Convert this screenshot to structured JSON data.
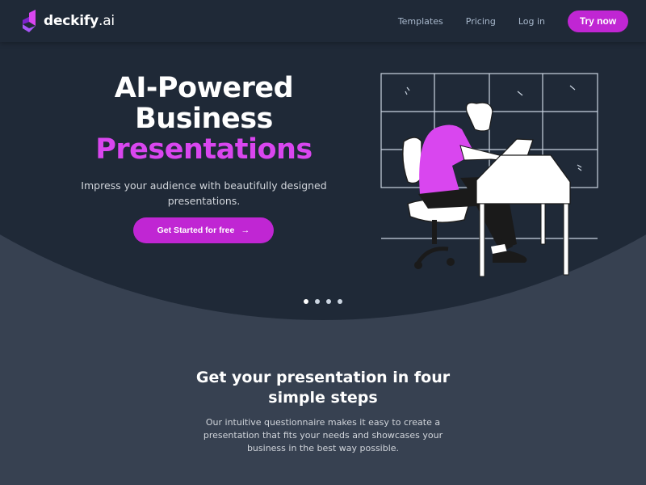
{
  "brand": {
    "name": "deckify",
    "suffix": ".ai",
    "colors": {
      "accent": "#c026d3",
      "accent_light": "#d946ef",
      "hero_bg": "#1f2937",
      "page_bg": "#374151"
    }
  },
  "nav": {
    "links": [
      {
        "label": "Templates"
      },
      {
        "label": "Pricing"
      },
      {
        "label": "Log in"
      }
    ],
    "cta_label": "Try now"
  },
  "hero": {
    "title_line1": "AI-Powered",
    "title_line2": "Business",
    "title_accent": "Presentations",
    "subtitle": "Impress your audience with beautifully designed presentations.",
    "cta_label": "Get Started for free",
    "cta_icon": "arrow-right-icon",
    "illustration": "person-working-at-laptop-desk",
    "carousel": {
      "total": 4,
      "active": 1
    }
  },
  "steps_section": {
    "title": "Get your presentation in four simple steps",
    "description": "Our intuitive questionnaire makes it easy to create a presentation that fits your needs and showcases your business in the best way possible."
  }
}
